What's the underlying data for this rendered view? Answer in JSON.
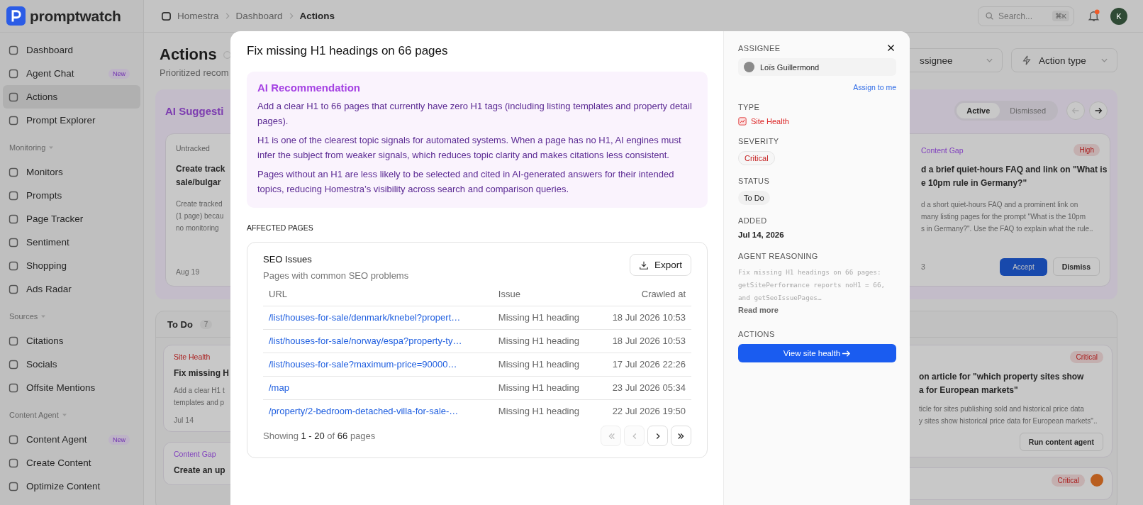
{
  "sidebar": {
    "logo": "promptwatch",
    "sections": [
      {
        "items": [
          {
            "label": "Dashboard",
            "selected": false
          },
          {
            "label": "Agent Chat",
            "selected": false,
            "badge": "New"
          },
          {
            "label": "Actions",
            "selected": true
          },
          {
            "label": "Prompt Explorer",
            "selected": false
          }
        ]
      },
      {
        "heading": "Monitoring",
        "items": [
          {
            "label": "Monitors",
            "selected": false
          },
          {
            "label": "Prompts",
            "selected": false
          },
          {
            "label": "Page Tracker",
            "selected": false
          },
          {
            "label": "Sentiment",
            "selected": false
          },
          {
            "label": "Shopping",
            "selected": false
          },
          {
            "label": "Ads Radar",
            "selected": false
          }
        ]
      },
      {
        "heading": "Sources",
        "items": [
          {
            "label": "Citations",
            "selected": false
          },
          {
            "label": "Socials",
            "selected": false
          },
          {
            "label": "Offsite Mentions",
            "selected": false
          }
        ]
      },
      {
        "heading": "Content Agent",
        "items": [
          {
            "label": "Content Agent",
            "selected": false,
            "badge": "New"
          },
          {
            "label": "Create Content",
            "selected": false
          },
          {
            "label": "Optimize Content",
            "selected": false
          }
        ]
      }
    ]
  },
  "header": {
    "breadcrumb": [
      "Homestra",
      "Dashboard",
      "Actions"
    ],
    "search": {
      "placeholder": "Search...",
      "shortcut": "⌘K"
    },
    "avatar": "K"
  },
  "page": {
    "title": "Actions",
    "subtitle": "Prioritized recom",
    "filters": [
      "ssignee",
      "Action type"
    ]
  },
  "suggestions": {
    "title": "AI Suggesti",
    "tabs": [
      {
        "label": "Active",
        "selected": true
      },
      {
        "label": "Dismissed",
        "selected": false
      }
    ],
    "left_card": {
      "tag": "Untracked",
      "color": "#5c5c5c",
      "title_lines": [
        "Create track",
        "sale/bulgar"
      ],
      "body_lines": [
        "Create tracked",
        "(1 page) becau",
        "no monitoring"
      ],
      "date": "Aug 19"
    },
    "right_card": {
      "tag": "Content Gap",
      "color": "#8141be",
      "severity": "High",
      "title_lines": [
        "d a brief quiet-hours FAQ and link on \"What is",
        "e 10pm rule in Germany?\""
      ],
      "body_lines": [
        "d a short quiet-hours FAQ and a prominent link on",
        "many listing pages for the prompt \"What is the 10pm",
        "s in Germany?\". Use the FAQ to explain what the rule.."
      ],
      "date": "3",
      "buttons": [
        "Accept",
        "Dismiss"
      ]
    }
  },
  "todo": {
    "title": "To Do",
    "count": "7",
    "left_cards": [
      {
        "tag": "Site Health",
        "color": "#a91d1d",
        "title_lines": [
          "Fix missing H"
        ],
        "body_lines": [
          "Add a clear H1 t",
          "templates and p"
        ],
        "date": "Jul 14"
      },
      {
        "tag": "Content Gap",
        "color": "#8141be",
        "title_lines": [
          "Create an up"
        ]
      }
    ],
    "right_cards": [
      {
        "severity": "Critical",
        "title_lines": [
          "on article for \"which property sites show",
          "a for European markets\""
        ],
        "body_lines": [
          "ticle for sites publishing sold and historical price data",
          "y sites show historical price data for European markets\".."
        ],
        "button": "Run content agent"
      },
      {
        "severity": "Critical"
      }
    ]
  },
  "modal": {
    "title": "Fix missing H1 headings on 66 pages",
    "recommendation": {
      "title": "AI Recommendation",
      "paragraphs": [
        "Add a clear H1 to 66 pages that currently have zero H1 tags (including listing templates and property detail pages).",
        "H1 is one of the clearest topic signals for automated systems. When a page has no H1, AI engines must infer the subject from weaker signals, which reduces topic clarity and makes citations less consistent.",
        "Pages without an H1 are less likely to be selected and cited in AI-generated answers for their intended topics, reducing Homestra’s visibility across search and comparison queries."
      ]
    },
    "affected_label": "AFFECTED PAGES",
    "table": {
      "title": "SEO Issues",
      "subtitle": "Pages with common SEO problems",
      "export": "Export",
      "columns": [
        "URL",
        "Issue",
        "Crawled at"
      ],
      "rows": [
        {
          "url": "/list/houses-for-sale/denmark/knebel?propert…",
          "issue": "Missing H1 heading",
          "crawled": "18 Jul 2026 10:53"
        },
        {
          "url": "/list/houses-for-sale/norway/espa?property-ty…",
          "issue": "Missing H1 heading",
          "crawled": "18 Jul 2026 10:53"
        },
        {
          "url": "/list/houses-for-sale?maximum-price=90000…",
          "issue": "Missing H1 heading",
          "crawled": "17 Jul 2026 22:26"
        },
        {
          "url": "/map",
          "issue": "Missing H1 heading",
          "crawled": "23 Jul 2026 05:34"
        },
        {
          "url": "/property/2-bedroom-detached-villa-for-sale-…",
          "issue": "Missing H1 heading",
          "crawled": "22 Jul 2026 19:50"
        }
      ],
      "footer": "Showing **1 - 20** of **66** pages",
      "pager": [
        {
          "kind": "first",
          "disabled": true
        },
        {
          "kind": "prev",
          "disabled": true
        },
        {
          "kind": "next",
          "disabled": false
        },
        {
          "kind": "last",
          "disabled": false
        }
      ]
    },
    "details": {
      "assignee_label": "ASSIGNEE",
      "assignee": "Loïs Guillermond",
      "assign_link": "Assign to me",
      "type_label": "TYPE",
      "type": "Site Health",
      "severity_label": "SEVERITY",
      "severity": "Critical",
      "status_label": "STATUS",
      "status": "To Do",
      "added_label": "ADDED",
      "added": "Jul 14, 2026",
      "reasoning_label": "AGENT REASONING",
      "reasoning": "Fix missing H1 headings on 66 pages: getSitePerformance reports noH1 = 66, and getSeoIssuePages…",
      "read_more": "Read more",
      "actions_label": "ACTIONS",
      "action_button": "View site health"
    }
  }
}
